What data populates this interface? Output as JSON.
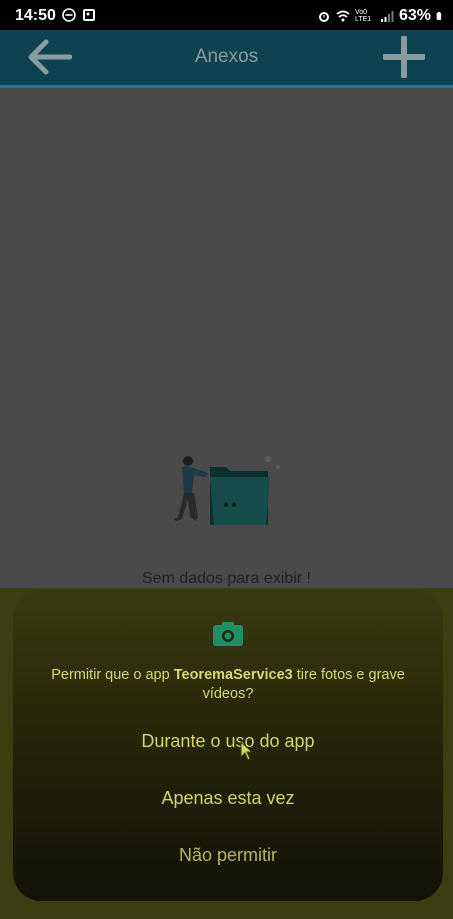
{
  "status_bar": {
    "time": "14:50",
    "battery": "63%",
    "network_label": "Vo0 LTE1"
  },
  "header": {
    "title": "Anexos"
  },
  "empty_state": {
    "message": "Sem dados para exibir !"
  },
  "dialog": {
    "message_prefix": "Permitir que o app ",
    "app_name": "TeoremaService3",
    "message_suffix": " tire fotos e grave vídeos?",
    "options": [
      "Durante o uso do app",
      "Apenas esta vez",
      "Não permitir"
    ]
  },
  "colors": {
    "header_bg": "#0e4250",
    "header_underline": "#1f7aa3",
    "dim_overlay": "#4a4a4a",
    "dialog_text": "#d7d36c",
    "camera_icon": "#1f8f6a"
  }
}
